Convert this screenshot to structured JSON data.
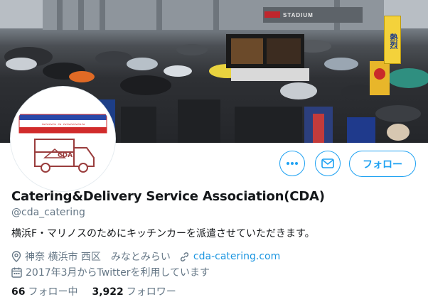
{
  "banner": {
    "stadium_sign": "STADIUM",
    "flag_text": "熱烈"
  },
  "avatar": {
    "logo_text": "CDA",
    "banner_text": "Yokohama F·Marinos"
  },
  "actions": {
    "more_icon": "more-dots-icon",
    "message_icon": "mail-icon",
    "follow_label": "フォロー"
  },
  "profile": {
    "display_name": "Catering&Delivery Service Association(CDA)",
    "handle": "@cda_catering",
    "bio": "横浜F・マリノスのためにキッチンカーを派遣させていただきます。",
    "location": "神奈 横浜市 西区　みなとみらい",
    "website": "cda-catering.com",
    "joined": "2017年3月からTwitterを利用しています"
  },
  "stats": {
    "following_count": "66",
    "following_label": "フォロー中",
    "followers_count": "3,922",
    "followers_label": "フォロワー"
  },
  "colors": {
    "accent": "#1da1f2",
    "secondary_text": "#657786",
    "primary_text": "#14171a"
  }
}
